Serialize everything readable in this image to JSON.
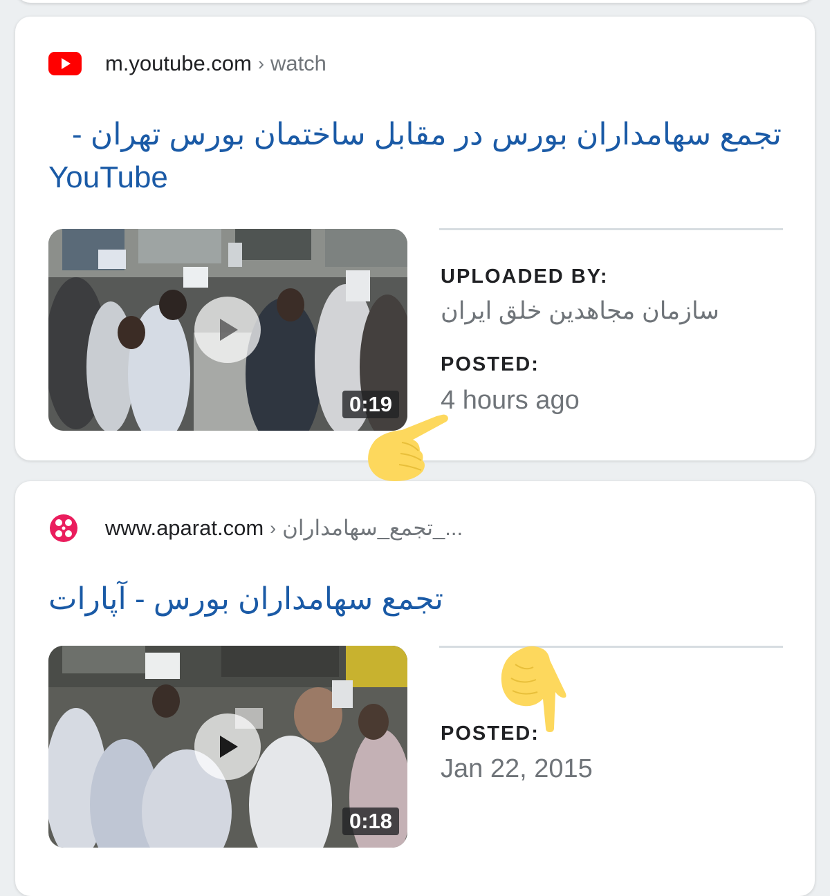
{
  "results": [
    {
      "domain": "m.youtube.com",
      "breadcrumb_separator": "›",
      "breadcrumb": "watch",
      "favicon_icon": "youtube-icon",
      "title_line1": "تجمع سهامداران بورس در مقابل ساختمان بورس تهران -",
      "title_line2": "YouTube",
      "duration": "0:19",
      "uploaded_by_label": "UPLOADED BY:",
      "uploaded_by_value": "سازمان مجاهدین خلق ایران",
      "posted_label": "POSTED:",
      "posted_value": "4 hours ago"
    },
    {
      "domain": "www.aparat.com",
      "breadcrumb_separator": "›",
      "breadcrumb": "تجمع_سهامداران_...",
      "favicon_icon": "aparat-icon",
      "title": "تجمع سهامداران بورس - آپارات",
      "duration": "0:18",
      "posted_label": "POSTED:",
      "posted_value": "Jan 22, 2015"
    }
  ],
  "colors": {
    "title_link": "#1a5aa6",
    "youtube_red": "#ff0000",
    "aparat_pink": "#ea1d5d",
    "annotation_yellow": "#fdd85d"
  },
  "icons": [
    "youtube-icon",
    "aparat-icon",
    "play-icon",
    "pointing-hand-icon"
  ]
}
